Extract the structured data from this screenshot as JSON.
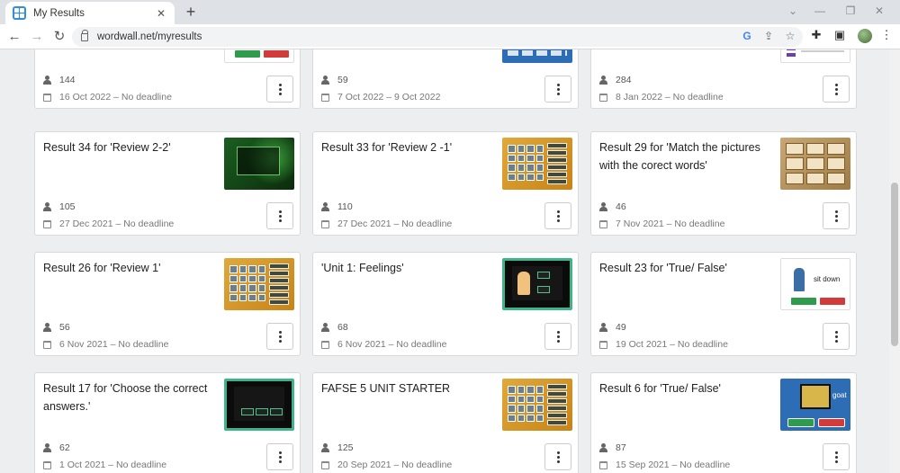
{
  "browser": {
    "tab_title": "My Results",
    "new_tab": "+",
    "tab_close": "✕",
    "url": "wordwall.net/myresults",
    "win_min": "⌄",
    "win_minimize": "—",
    "win_restore": "❐",
    "win_close": "✕"
  },
  "cards": [
    {
      "title": "",
      "players": "144",
      "date": "16 Oct 2022 – No deadline",
      "thumb": "white-truefalse"
    },
    {
      "title": "",
      "players": "59",
      "date": "7 Oct 2022 – 9 Oct 2022",
      "thumb": "blue-plain"
    },
    {
      "title": "",
      "players": "284",
      "date": "8 Jan 2022 – No deadline",
      "thumb": "white-list"
    },
    {
      "title": "Result 34 for 'Review 2-2'",
      "players": "105",
      "date": "27 Dec 2021 – No deadline",
      "thumb": "green"
    },
    {
      "title": "Result 33 for 'Review 2 -1'",
      "players": "110",
      "date": "27 Dec 2021 – No deadline",
      "thumb": "orange"
    },
    {
      "title": "Result 29 for 'Match the pictures with the corect words'",
      "players": "46",
      "date": "7 Nov 2021 – No deadline",
      "thumb": "tan"
    },
    {
      "title": "Result 26 for 'Review 1'",
      "players": "56",
      "date": "6 Nov 2021 – No deadline",
      "thumb": "orange"
    },
    {
      "title": "'Unit 1: Feelings'",
      "players": "68",
      "date": "6 Nov 2021 – No deadline",
      "thumb": "film-person"
    },
    {
      "title": "Result 23 for 'True/ False'",
      "players": "49",
      "date": "19 Oct 2021 – No deadline",
      "thumb": "white-sitdown"
    },
    {
      "title": "Result 17 for 'Choose the correct answers.'",
      "players": "62",
      "date": "1 Oct 2021 – No deadline",
      "thumb": "film"
    },
    {
      "title": "FAFSE 5 UNIT STARTER",
      "players": "125",
      "date": "20 Sep 2021 – No deadline",
      "thumb": "orange"
    },
    {
      "title": "Result 6 for 'True/ False'",
      "players": "87",
      "date": "15 Sep 2021 – No deadline",
      "thumb": "blue-goat"
    }
  ],
  "thumb_text": {
    "sit_down": "sit down",
    "goat": "goat"
  }
}
